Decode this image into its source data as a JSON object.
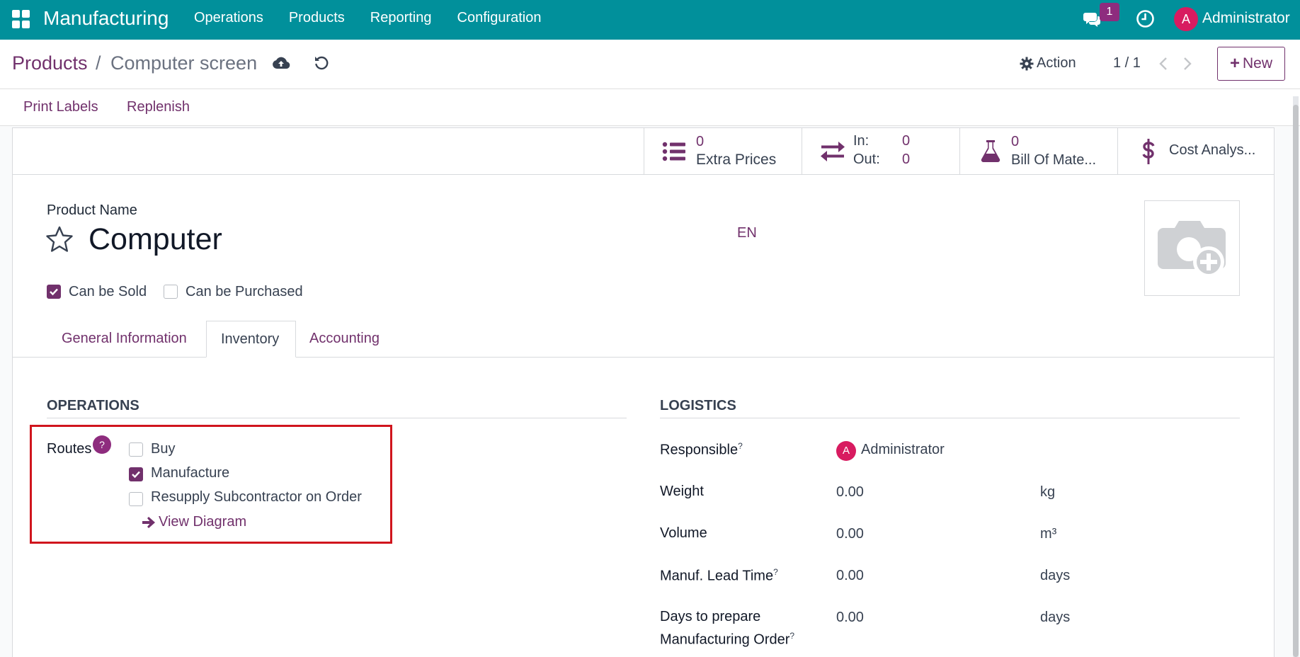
{
  "navbar": {
    "brand": "Manufacturing",
    "menu": [
      "Operations",
      "Products",
      "Reporting",
      "Configuration"
    ],
    "chat_badge": "1",
    "user_initial": "A",
    "user_name": "Administrator",
    "color": "#01909b"
  },
  "control": {
    "breadcrumb_root": "Products",
    "breadcrumb_sep": "/",
    "breadcrumb_current": "Computer screen",
    "action_label": "Action",
    "pager": "1 / 1",
    "new_label": "New"
  },
  "buttonbar": {
    "print_labels": "Print Labels",
    "replenish": "Replenish"
  },
  "smart_buttons": {
    "extra_prices": {
      "value": "0",
      "label": "Extra Prices"
    },
    "in_out": {
      "in_label": "In:",
      "in_value": "0",
      "out_label": "Out:",
      "out_value": "0"
    },
    "bom": {
      "value": "0",
      "label": "Bill Of Mate..."
    },
    "cost": {
      "label": "Cost Analys..."
    }
  },
  "product": {
    "name_label": "Product Name",
    "name": "Computer",
    "lang": "EN",
    "can_be_sold": {
      "label": "Can be Sold",
      "checked": true
    },
    "can_be_purchased": {
      "label": "Can be Purchased",
      "checked": false
    }
  },
  "tabs": [
    {
      "label": "General Information",
      "active": false
    },
    {
      "label": "Inventory",
      "active": true
    },
    {
      "label": "Accounting",
      "active": false
    }
  ],
  "operations": {
    "title": "OPERATIONS",
    "routes_label": "Routes",
    "help": "?",
    "routes": [
      {
        "label": "Buy",
        "checked": false
      },
      {
        "label": "Manufacture",
        "checked": true
      },
      {
        "label": "Resupply Subcontractor on Order",
        "checked": false
      }
    ],
    "view_diagram": "View Diagram",
    "highlight_color": "#d0151d"
  },
  "logistics": {
    "title": "LOGISTICS",
    "responsible_label": "Responsible",
    "responsible_initial": "A",
    "responsible_name": "Administrator",
    "weight_label": "Weight",
    "weight_value": "0.00",
    "weight_unit": "kg",
    "volume_label": "Volume",
    "volume_value": "0.00",
    "volume_unit": "m³",
    "lead_time_label": "Manuf. Lead Time",
    "lead_time_value": "0.00",
    "lead_time_unit": "days",
    "days_prepare_label_1": "Days to prepare",
    "days_prepare_label_2": "Manufacturing Order",
    "days_prepare_value": "0.00",
    "days_prepare_unit": "days",
    "sup": "?"
  },
  "accent_color": "#71316c"
}
